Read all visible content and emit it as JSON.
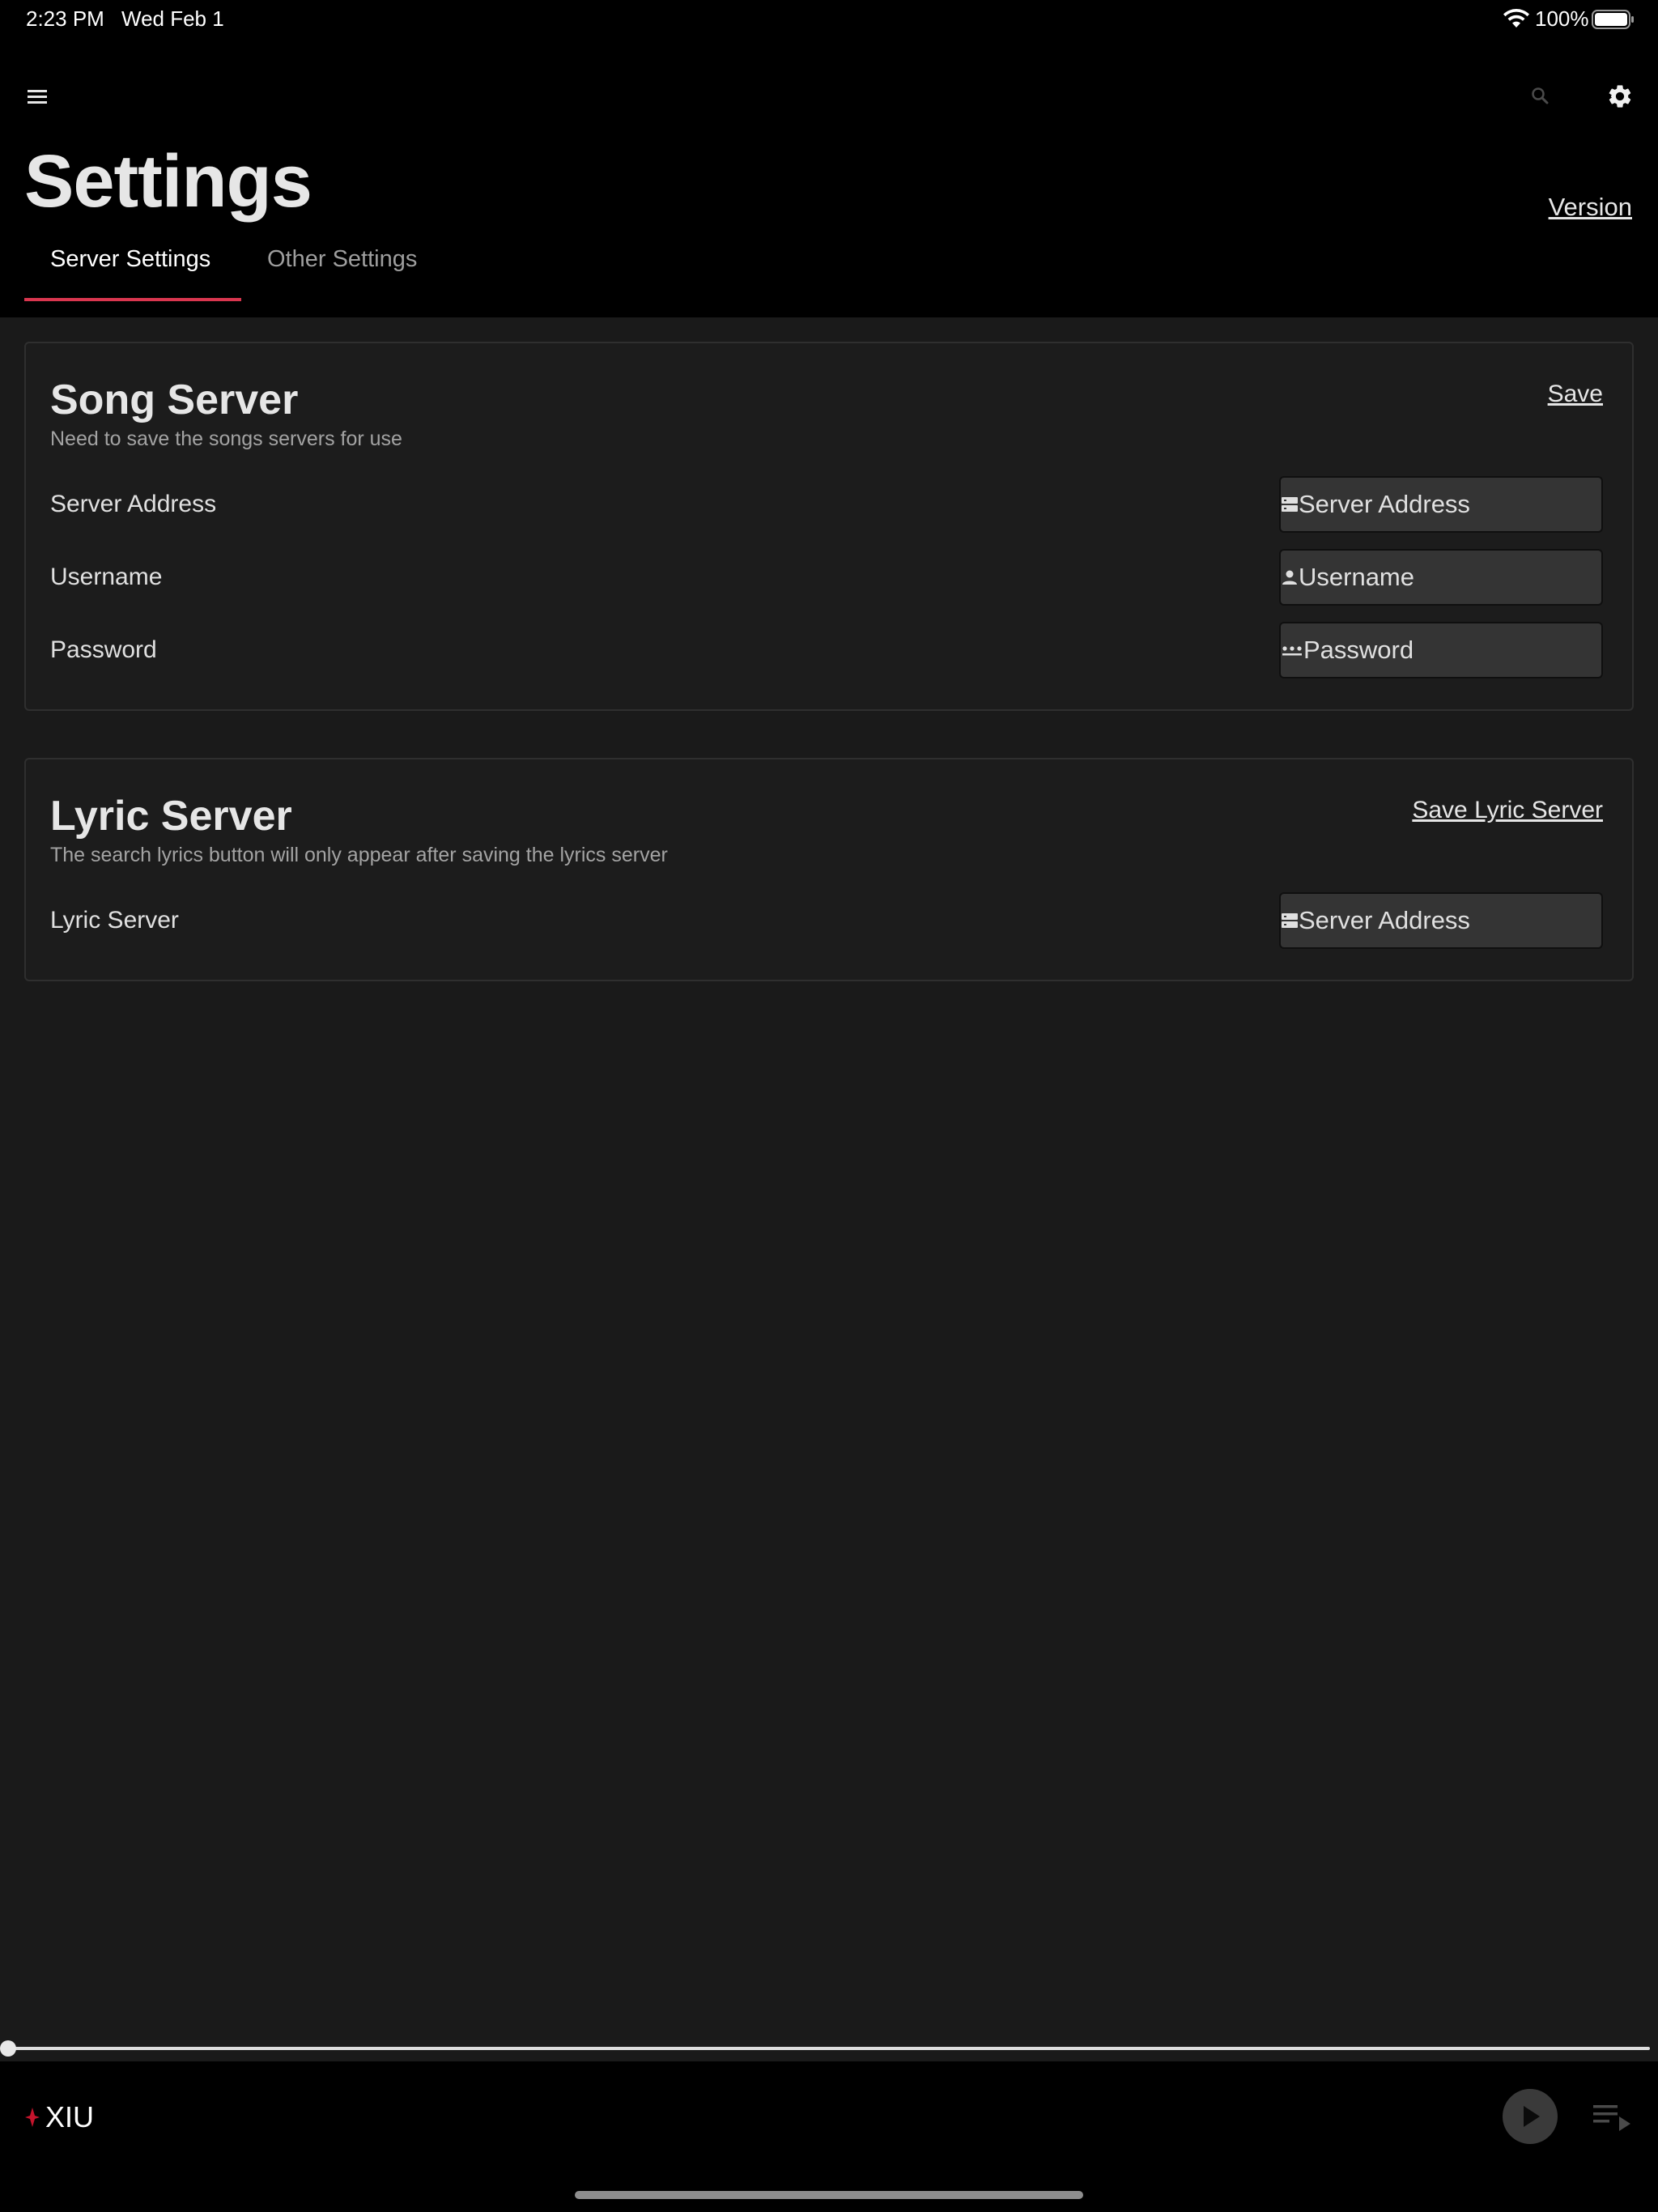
{
  "status_bar": {
    "time": "2:23 PM",
    "date": "Wed Feb 1",
    "battery": "100%"
  },
  "header": {
    "title": "Settings",
    "version_link": "Version",
    "tabs": [
      {
        "label": "Server Settings",
        "active": true
      },
      {
        "label": "Other Settings",
        "active": false
      }
    ],
    "icons": [
      "menu-icon",
      "search-icon",
      "gear-icon"
    ]
  },
  "song_server": {
    "title": "Song Server",
    "subtitle": "Need to save the songs servers for use",
    "save_label": "Save",
    "rows": [
      {
        "label": "Server Address",
        "placeholder": "Server Address",
        "icon": "server-icon"
      },
      {
        "label": "Username",
        "placeholder": "Username",
        "icon": "person-icon"
      },
      {
        "label": "Password",
        "placeholder": "Password",
        "icon": "password-icon"
      }
    ]
  },
  "lyric_server": {
    "title": "Lyric Server",
    "subtitle": "The search lyrics button will only appear after saving the lyrics server",
    "save_label": "Save Lyric Server",
    "rows": [
      {
        "label": "Lyric Server",
        "placeholder": "Server Address",
        "icon": "server-icon"
      }
    ]
  },
  "player": {
    "logo_text": "XIU",
    "progress": 0,
    "icons": [
      "play-icon",
      "queue-icon"
    ]
  },
  "colors": {
    "accent": "#d9364f",
    "header_bg": "#000000",
    "page_bg": "#1a1a1a",
    "field_bg": "#343434"
  }
}
